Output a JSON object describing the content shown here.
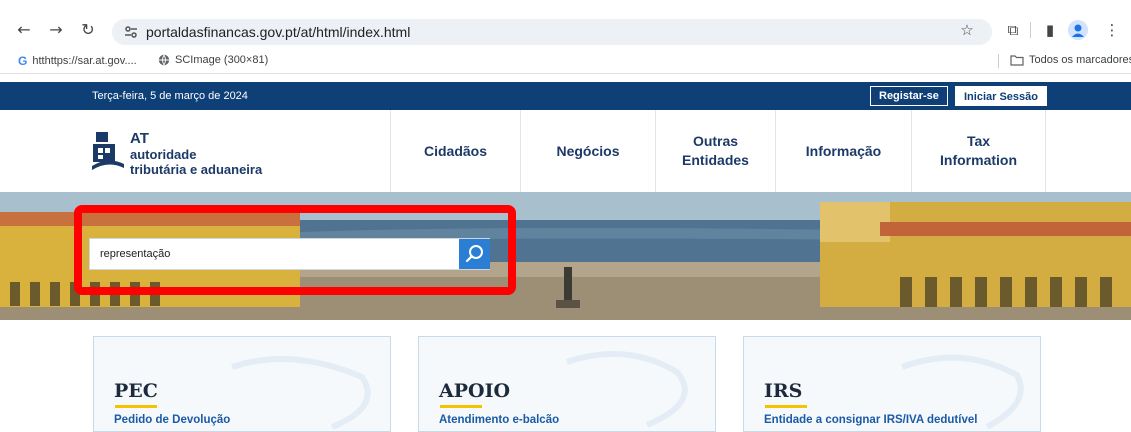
{
  "browser": {
    "url": "portaldasfinancas.gov.pt/at/html/index.html",
    "bookmarks": [
      {
        "label": "htthttps://sar.at.gov....",
        "icon": "google-icon"
      },
      {
        "label": "SCImage (300×81)",
        "icon": "globe-icon"
      }
    ],
    "all_bookmarks_label": "Todos os marcadores"
  },
  "topbar": {
    "date": "Terça-feira, 5 de março de 2024",
    "register_label": "Registar-se",
    "login_label": "Iniciar Sessão",
    "bg_color": "#0e3f77"
  },
  "logo": {
    "at": "AT",
    "line1": "autoridade",
    "line2": "tributária e aduaneira"
  },
  "menu": {
    "items": [
      {
        "label": "Cidadãos"
      },
      {
        "label": "Negócios"
      },
      {
        "label": "Outras Entidades"
      },
      {
        "label": "Informação"
      },
      {
        "label": "Tax Information"
      }
    ]
  },
  "search": {
    "value": "representação",
    "button_color": "#2a7fd4",
    "highlight_color": "#ff0000"
  },
  "cards": [
    {
      "title": "PEC",
      "subtitle": "Pedido de Devolução"
    },
    {
      "title": "APOIO",
      "subtitle": "Atendimento e-balcão"
    },
    {
      "title": "IRS",
      "subtitle": "Entidade a consignar IRS/IVA dedutível"
    }
  ]
}
